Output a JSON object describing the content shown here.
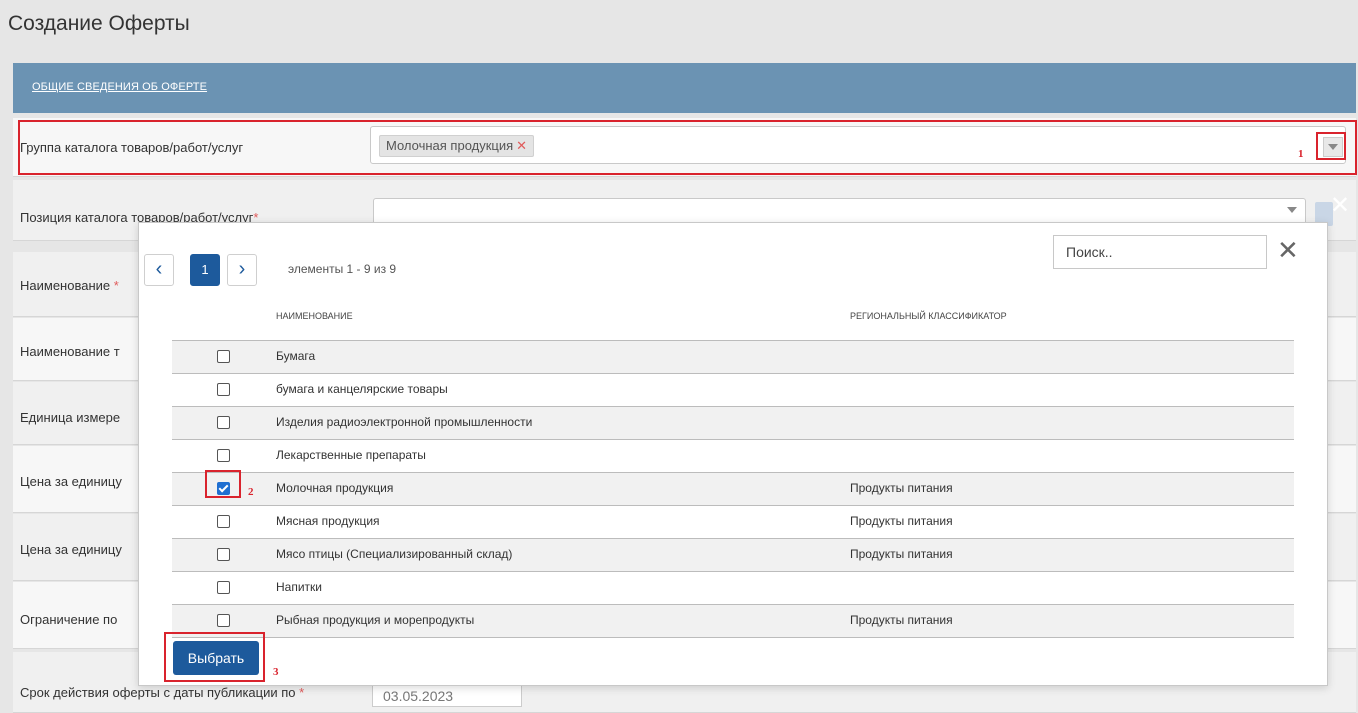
{
  "page": {
    "title": "Создание Оферты"
  },
  "section": {
    "title": "ОБЩИЕ СВЕДЕНИЯ ОБ ОФЕРТЕ"
  },
  "form": {
    "rows": [
      {
        "label": "Группа каталога товаров/работ/услуг",
        "required": false
      },
      {
        "label": "Позиция каталога товаров/работ/услуг",
        "required": true
      },
      {
        "label": "Наименование",
        "required": true
      },
      {
        "label": "Наименование т",
        "required": false
      },
      {
        "label": "Единица измере",
        "required": false
      },
      {
        "label": "Цена за единицу",
        "required": false
      },
      {
        "label": "Цена за единицу",
        "required": false
      },
      {
        "label": "Ограничение по",
        "required": false
      },
      {
        "label": "Срок действия оферты с даты публикации по",
        "required": true
      }
    ],
    "catalog_group_tag": "Молочная продукция",
    "date_value": "03.05.2023"
  },
  "annotations": {
    "a1": "1",
    "a2": "2",
    "a3": "3"
  },
  "modal": {
    "pagination": {
      "prev": "‹",
      "current": "1",
      "next": "›",
      "info": "элементы 1 - 9 из 9"
    },
    "search_placeholder": "Поиск..",
    "close": "✕",
    "columns": [
      "НАИМЕНОВАНИЕ",
      "РЕГИОНАЛЬНЫЙ КЛАССИФИКАТОР"
    ],
    "rows": [
      {
        "name": "Бумага",
        "region": "",
        "checked": false
      },
      {
        "name": "бумага и канцелярские товары",
        "region": "",
        "checked": false
      },
      {
        "name": "Изделия радиоэлектронной промышленности",
        "region": "",
        "checked": false
      },
      {
        "name": "Лекарственные препараты",
        "region": "",
        "checked": false
      },
      {
        "name": "Молочная продукция",
        "region": "Продукты питания",
        "checked": true
      },
      {
        "name": "Мясная продукция",
        "region": "Продукты питания",
        "checked": false
      },
      {
        "name": "Мясо птицы (Специализированный склад)",
        "region": "Продукты питания",
        "checked": false
      },
      {
        "name": "Напитки",
        "region": "",
        "checked": false
      },
      {
        "name": "Рыбная продукция и морепродукты",
        "region": "Продукты питания",
        "checked": false
      }
    ],
    "select_button": "Выбрать"
  },
  "colors": {
    "header_bg": "#6b93b3",
    "primary": "#1d5a9c",
    "annotation": "#d9232d"
  }
}
